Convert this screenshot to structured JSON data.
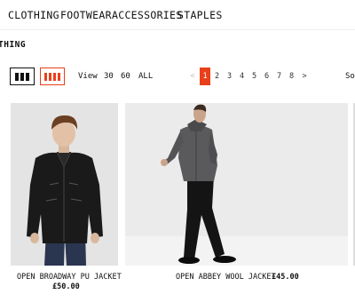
{
  "nav": {
    "items": [
      {
        "label": "CLOTHING"
      },
      {
        "label": "FOOTWEAR"
      },
      {
        "label": "ACCESSORIES"
      },
      {
        "label": "STAPLES"
      }
    ]
  },
  "page": {
    "title": "THING"
  },
  "toolbar": {
    "view_label": "View",
    "per_page": [
      "30",
      "60",
      "ALL"
    ],
    "grid_icons": [
      "grid-3-icon",
      "grid-4-icon"
    ],
    "active_grid": "grid-4",
    "sort_label": "So"
  },
  "pagination": {
    "prev": "<",
    "current": "1",
    "pages": [
      "1",
      "2",
      "3",
      "4",
      "5",
      "6",
      "7",
      "8"
    ],
    "next": ">"
  },
  "products": [
    {
      "name": "OPEN BROADWAY PU JACKET",
      "price": "£50.00"
    },
    {
      "name": "OPEN ABBEY WOOL JACKET",
      "price": "£45.00"
    }
  ],
  "colors": {
    "accent": "#e8401a",
    "text": "#111111"
  }
}
